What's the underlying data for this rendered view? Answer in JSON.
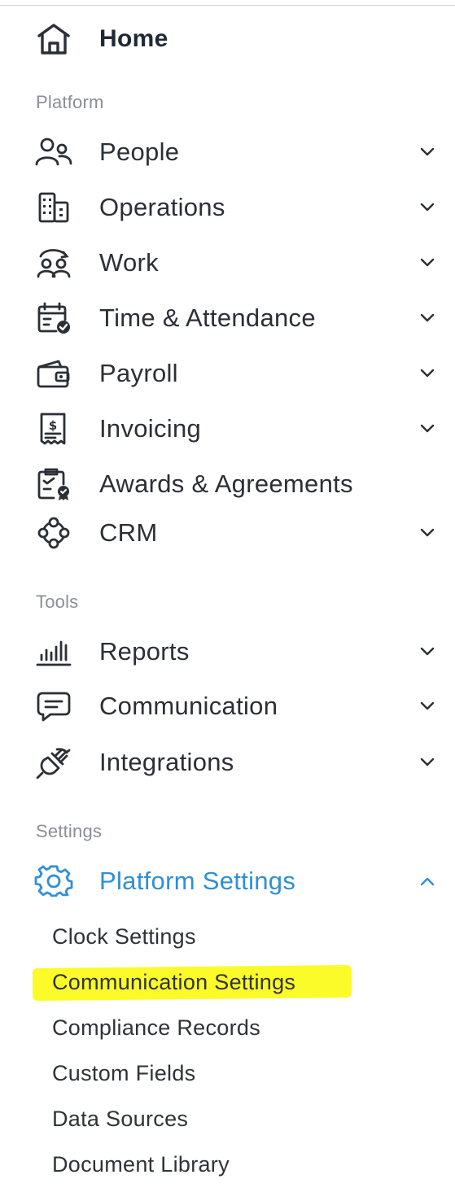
{
  "nav": {
    "home_label": "Home",
    "sections": {
      "platform": "Platform",
      "tools": "Tools",
      "settings": "Settings"
    },
    "platform_items": [
      {
        "label": "People",
        "icon": "people-icon",
        "expandable": true
      },
      {
        "label": "Operations",
        "icon": "building-icon",
        "expandable": true
      },
      {
        "label": "Work",
        "icon": "work-team-icon",
        "expandable": true
      },
      {
        "label": "Time & Attendance",
        "icon": "calendar-check-icon",
        "expandable": true
      },
      {
        "label": "Payroll",
        "icon": "wallet-icon",
        "expandable": true
      },
      {
        "label": "Invoicing",
        "icon": "invoice-dollar-icon",
        "expandable": true
      },
      {
        "label": "Awards & Agreements",
        "icon": "award-document-icon",
        "expandable": false
      },
      {
        "label": "CRM",
        "icon": "crm-network-icon",
        "expandable": true
      }
    ],
    "tools_items": [
      {
        "label": "Reports",
        "icon": "bar-chart-icon",
        "expandable": true
      },
      {
        "label": "Communication",
        "icon": "chat-bubble-icon",
        "expandable": true
      },
      {
        "label": "Integrations",
        "icon": "plug-icon",
        "expandable": true
      }
    ],
    "settings_item": {
      "label": "Platform Settings",
      "icon": "gear-icon",
      "expanded": true
    },
    "settings_subitems": [
      "Clock Settings",
      "Communication Settings",
      "Compliance Records",
      "Custom Fields",
      "Data Sources",
      "Document Library"
    ],
    "highlighted_subitem": "Communication Settings"
  },
  "colors": {
    "accent": "#2f8fd6",
    "text": "#2b2f36",
    "section_label": "#8a8f96",
    "highlight": "#fbfb2a"
  }
}
